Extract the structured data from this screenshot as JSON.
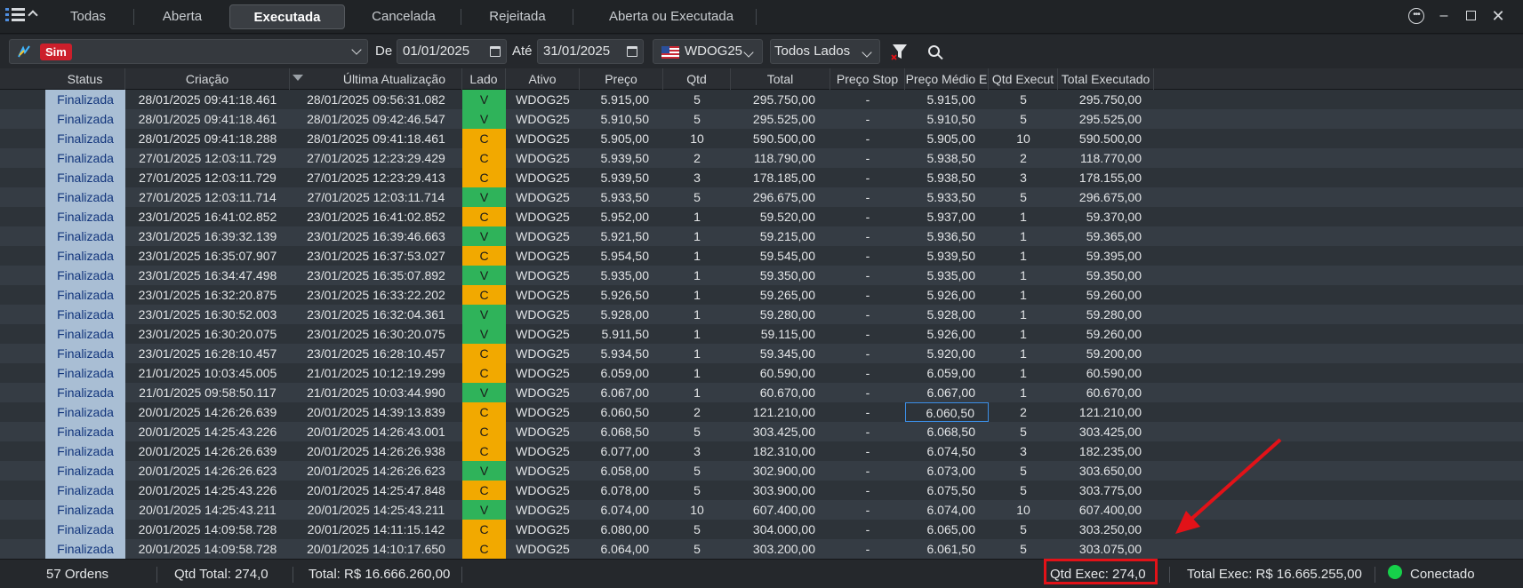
{
  "tabs": [
    "Todas",
    "Aberta",
    "Executada",
    "Cancelada",
    "Rejeitada",
    "Aberta ou Executada"
  ],
  "active_tab": "Executada",
  "filter": {
    "account_badge": "Sim",
    "de_label": "De",
    "date_from": "01/01/2025",
    "ate_label": "Até",
    "date_to": "31/01/2025",
    "asset": "WDOG25",
    "side": "Todos Lados"
  },
  "columns": [
    "Status",
    "Criação",
    "Última Atualização",
    "Lado",
    "Ativo",
    "Preço",
    "Qtd",
    "Total",
    "Preço Stop",
    "Preço Médio E",
    "Qtd Execut",
    "Total Executado"
  ],
  "rows": [
    [
      "Finalizada",
      "28/01/2025 09:41:18.461",
      "28/01/2025 09:56:31.082",
      "V",
      "WDOG25",
      "5.915,00",
      "5",
      "295.750,00",
      "-",
      "5.915,00",
      "5",
      "295.750,00"
    ],
    [
      "Finalizada",
      "28/01/2025 09:41:18.461",
      "28/01/2025 09:42:46.547",
      "V",
      "WDOG25",
      "5.910,50",
      "5",
      "295.525,00",
      "-",
      "5.910,50",
      "5",
      "295.525,00"
    ],
    [
      "Finalizada",
      "28/01/2025 09:41:18.288",
      "28/01/2025 09:41:18.461",
      "C",
      "WDOG25",
      "5.905,00",
      "10",
      "590.500,00",
      "-",
      "5.905,00",
      "10",
      "590.500,00"
    ],
    [
      "Finalizada",
      "27/01/2025 12:03:11.729",
      "27/01/2025 12:23:29.429",
      "C",
      "WDOG25",
      "5.939,50",
      "2",
      "118.790,00",
      "-",
      "5.938,50",
      "2",
      "118.770,00"
    ],
    [
      "Finalizada",
      "27/01/2025 12:03:11.729",
      "27/01/2025 12:23:29.413",
      "C",
      "WDOG25",
      "5.939,50",
      "3",
      "178.185,00",
      "-",
      "5.938,50",
      "3",
      "178.155,00"
    ],
    [
      "Finalizada",
      "27/01/2025 12:03:11.714",
      "27/01/2025 12:03:11.714",
      "V",
      "WDOG25",
      "5.933,50",
      "5",
      "296.675,00",
      "-",
      "5.933,50",
      "5",
      "296.675,00"
    ],
    [
      "Finalizada",
      "23/01/2025 16:41:02.852",
      "23/01/2025 16:41:02.852",
      "C",
      "WDOG25",
      "5.952,00",
      "1",
      "59.520,00",
      "-",
      "5.937,00",
      "1",
      "59.370,00"
    ],
    [
      "Finalizada",
      "23/01/2025 16:39:32.139",
      "23/01/2025 16:39:46.663",
      "V",
      "WDOG25",
      "5.921,50",
      "1",
      "59.215,00",
      "-",
      "5.936,50",
      "1",
      "59.365,00"
    ],
    [
      "Finalizada",
      "23/01/2025 16:35:07.907",
      "23/01/2025 16:37:53.027",
      "C",
      "WDOG25",
      "5.954,50",
      "1",
      "59.545,00",
      "-",
      "5.939,50",
      "1",
      "59.395,00"
    ],
    [
      "Finalizada",
      "23/01/2025 16:34:47.498",
      "23/01/2025 16:35:07.892",
      "V",
      "WDOG25",
      "5.935,00",
      "1",
      "59.350,00",
      "-",
      "5.935,00",
      "1",
      "59.350,00"
    ],
    [
      "Finalizada",
      "23/01/2025 16:32:20.875",
      "23/01/2025 16:33:22.202",
      "C",
      "WDOG25",
      "5.926,50",
      "1",
      "59.265,00",
      "-",
      "5.926,00",
      "1",
      "59.260,00"
    ],
    [
      "Finalizada",
      "23/01/2025 16:30:52.003",
      "23/01/2025 16:32:04.361",
      "V",
      "WDOG25",
      "5.928,00",
      "1",
      "59.280,00",
      "-",
      "5.928,00",
      "1",
      "59.280,00"
    ],
    [
      "Finalizada",
      "23/01/2025 16:30:20.075",
      "23/01/2025 16:30:20.075",
      "V",
      "WDOG25",
      "5.911,50",
      "1",
      "59.115,00",
      "-",
      "5.926,00",
      "1",
      "59.260,00"
    ],
    [
      "Finalizada",
      "23/01/2025 16:28:10.457",
      "23/01/2025 16:28:10.457",
      "C",
      "WDOG25",
      "5.934,50",
      "1",
      "59.345,00",
      "-",
      "5.920,00",
      "1",
      "59.200,00"
    ],
    [
      "Finalizada",
      "21/01/2025 10:03:45.005",
      "21/01/2025 10:12:19.299",
      "C",
      "WDOG25",
      "6.059,00",
      "1",
      "60.590,00",
      "-",
      "6.059,00",
      "1",
      "60.590,00"
    ],
    [
      "Finalizada",
      "21/01/2025 09:58:50.117",
      "21/01/2025 10:03:44.990",
      "V",
      "WDOG25",
      "6.067,00",
      "1",
      "60.670,00",
      "-",
      "6.067,00",
      "1",
      "60.670,00"
    ],
    [
      "Finalizada",
      "20/01/2025 14:26:26.639",
      "20/01/2025 14:39:13.839",
      "C",
      "WDOG25",
      "6.060,50",
      "2",
      "121.210,00",
      "-",
      "6.060,50",
      "2",
      "121.210,00"
    ],
    [
      "Finalizada",
      "20/01/2025 14:25:43.226",
      "20/01/2025 14:26:43.001",
      "C",
      "WDOG25",
      "6.068,50",
      "5",
      "303.425,00",
      "-",
      "6.068,50",
      "5",
      "303.425,00"
    ],
    [
      "Finalizada",
      "20/01/2025 14:26:26.639",
      "20/01/2025 14:26:26.938",
      "C",
      "WDOG25",
      "6.077,00",
      "3",
      "182.310,00",
      "-",
      "6.074,50",
      "3",
      "182.235,00"
    ],
    [
      "Finalizada",
      "20/01/2025 14:26:26.623",
      "20/01/2025 14:26:26.623",
      "V",
      "WDOG25",
      "6.058,00",
      "5",
      "302.900,00",
      "-",
      "6.073,00",
      "5",
      "303.650,00"
    ],
    [
      "Finalizada",
      "20/01/2025 14:25:43.226",
      "20/01/2025 14:25:47.848",
      "C",
      "WDOG25",
      "6.078,00",
      "5",
      "303.900,00",
      "-",
      "6.075,50",
      "5",
      "303.775,00"
    ],
    [
      "Finalizada",
      "20/01/2025 14:25:43.211",
      "20/01/2025 14:25:43.211",
      "V",
      "WDOG25",
      "6.074,00",
      "10",
      "607.400,00",
      "-",
      "6.074,00",
      "10",
      "607.400,00"
    ],
    [
      "Finalizada",
      "20/01/2025 14:09:58.728",
      "20/01/2025 14:11:15.142",
      "C",
      "WDOG25",
      "6.080,00",
      "5",
      "304.000,00",
      "-",
      "6.065,00",
      "5",
      "303.250,00"
    ],
    [
      "Finalizada",
      "20/01/2025 14:09:58.728",
      "20/01/2025 14:10:17.650",
      "C",
      "WDOG25",
      "6.064,00",
      "5",
      "303.200,00",
      "-",
      "6.061,50",
      "5",
      "303.075,00"
    ]
  ],
  "selected_cell": {
    "row": 16,
    "col": 9
  },
  "statusbar": {
    "orders": "57 Ordens",
    "qtd_total": "Qtd Total: 274,0",
    "total": "Total: R$ 16.666.260,00",
    "qtd_exec": "Qtd Exec: 274,0",
    "total_exec": "Total Exec: R$ 16.665.255,00",
    "connection": "Conectado"
  },
  "colors": {
    "status_cell": "#a9bed4",
    "buy_c": "#f2a900",
    "sell_v": "#2fb35a",
    "sim_badge": "#cc1f2b",
    "connected": "#16d14a",
    "highlight": "#e21218"
  },
  "icons": [
    "menu-icon",
    "caret-up-icon",
    "options-icon",
    "minimize-icon",
    "maximize-icon",
    "close-icon",
    "account-icon",
    "calendar-icon",
    "us-flag-icon",
    "filter-icon",
    "search-icon",
    "sort-desc-icon"
  ]
}
